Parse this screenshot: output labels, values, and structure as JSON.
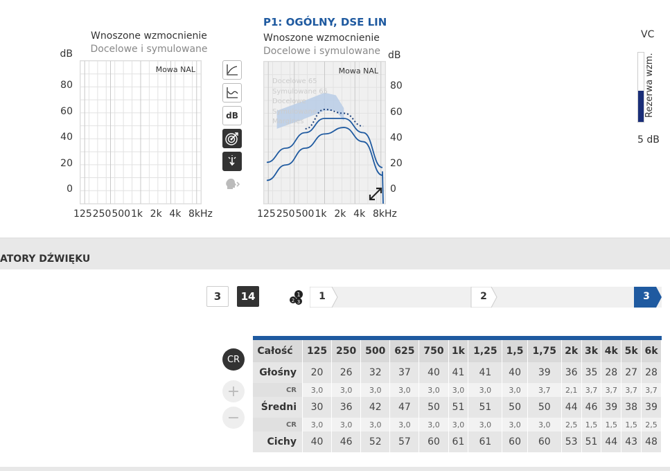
{
  "left_chart": {
    "title": "Wnoszone wzmocnienie",
    "subtitle": "Docelowe i symulowane",
    "y_unit": "dB",
    "rule_label": "Mowa NAL",
    "y_ticks": [
      "80",
      "60",
      "40",
      "20",
      "0"
    ],
    "x_ticks": [
      "125",
      "250",
      "500",
      "1k",
      "2k",
      "4k",
      "8kHz"
    ]
  },
  "right_chart": {
    "program_title": "P1: OGÓLNY, DSE LIN",
    "title": "Wnoszone wzmocnienie",
    "subtitle": "Docelowe i symulowane",
    "y_unit": "dB",
    "rule_label": "Mowa NAL",
    "y_ticks": [
      "80",
      "60",
      "40",
      "20",
      "0"
    ],
    "x_ticks": [
      "125",
      "250",
      "500",
      "1k",
      "2k",
      "4k",
      "8kHz"
    ],
    "legend_ghost": [
      "Docelowe 65",
      "Symulowane 65",
      "Docelowe",
      "Symulowane",
      "Margines"
    ]
  },
  "chart_data": {
    "type": "line",
    "x": [
      125,
      250,
      500,
      1000,
      2000,
      4000,
      8000
    ],
    "xscale": "log",
    "ylim": [
      -10,
      100
    ],
    "series": [
      {
        "values": [
          22,
          33,
          45,
          56,
          56,
          45,
          18
        ]
      },
      {
        "values": [
          8,
          20,
          33,
          44,
          49,
          38,
          12
        ]
      },
      {
        "values": [
          null,
          null,
          48,
          63,
          60,
          50,
          null
        ]
      }
    ]
  },
  "vc": {
    "label": "VC",
    "side_label": "Rezerwa wzm.",
    "value": "5 dB",
    "level_fraction": 0.45
  },
  "toolbar": {
    "icons": [
      "curve-icon",
      "io-curve-icon",
      "db-icon",
      "target-icon",
      "hand-point-icon",
      "speech-head-icon"
    ],
    "db_label": "dB"
  },
  "section": {
    "title": "ATORY DŹWIĘKU"
  },
  "channels": {
    "option_a": "3",
    "option_b": "14",
    "steps": [
      "1",
      "2",
      "3"
    ]
  },
  "gain_table": {
    "header_label": "Całość",
    "frequencies": [
      "125",
      "250",
      "500",
      "625",
      "750",
      "1k",
      "1,25",
      "1,5",
      "1,75",
      "2k",
      "3k",
      "4k",
      "5k",
      "6k"
    ],
    "rows": [
      {
        "label": "Głośny",
        "type": "loud",
        "values": [
          "20",
          "26",
          "32",
          "37",
          "40",
          "41",
          "41",
          "40",
          "39",
          "36",
          "35",
          "28",
          "27",
          "28"
        ]
      },
      {
        "label": "CR",
        "type": "cr",
        "values": [
          "3,0",
          "3,0",
          "3,0",
          "3,0",
          "3,0",
          "3,0",
          "3,0",
          "3,0",
          "3,7",
          "2,1",
          "3,7",
          "3,7",
          "3,7",
          "3,7"
        ]
      },
      {
        "label": "Średni",
        "type": "mid",
        "values": [
          "30",
          "36",
          "42",
          "47",
          "50",
          "51",
          "51",
          "50",
          "50",
          "44",
          "46",
          "39",
          "38",
          "39"
        ]
      },
      {
        "label": "CR",
        "type": "cr",
        "values": [
          "3,0",
          "3,0",
          "3,0",
          "3,0",
          "3,0",
          "3,0",
          "3,0",
          "3,0",
          "3,0",
          "2,5",
          "1,5",
          "1,5",
          "1,5",
          "2,5"
        ]
      },
      {
        "label": "Cichy",
        "type": "soft",
        "values": [
          "40",
          "46",
          "52",
          "57",
          "60",
          "61",
          "61",
          "60",
          "60",
          "53",
          "51",
          "44",
          "43",
          "48"
        ]
      }
    ]
  },
  "side_controls": {
    "cr_label": "CR",
    "plus_label": "+",
    "minus_label": "−"
  },
  "colors": {
    "accent": "#1f5aa0",
    "dark": "#333333",
    "band": "#b8cde6"
  }
}
